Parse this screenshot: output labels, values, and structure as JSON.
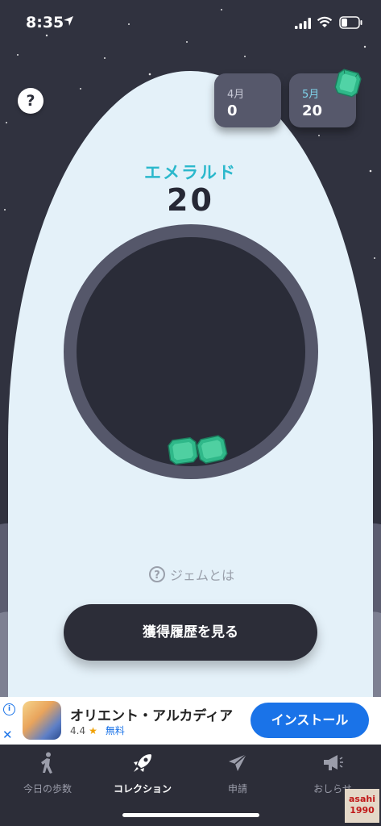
{
  "status_bar": {
    "time": "8:35"
  },
  "header": {
    "help_label": "?",
    "months": [
      {
        "label": "4月",
        "value": "0"
      },
      {
        "label": "5月",
        "value": "20"
      }
    ]
  },
  "gem": {
    "name": "エメラルド",
    "count": "20"
  },
  "what_gem_label": "ジェムとは",
  "what_gem_q": "?",
  "history_button": "獲得履歴を見る",
  "ad": {
    "title": "オリエント・アルカディア",
    "rating": "4.4",
    "price": "無料",
    "install": "インストール",
    "info": "i",
    "close": "✕"
  },
  "tabs": [
    {
      "label": "今日の歩数",
      "icon": "walking-person-icon"
    },
    {
      "label": "コレクション",
      "icon": "rocket-icon"
    },
    {
      "label": "申請",
      "icon": "paper-plane-icon"
    },
    {
      "label": "おしらせ",
      "icon": "megaphone-icon"
    }
  ],
  "watermark": {
    "line1": "asahi",
    "line2": "1990"
  },
  "colors": {
    "background": "#30323f",
    "rocket": "#e4f1f9",
    "accent": "#2bb8cc",
    "ad_button": "#1a73e8"
  }
}
